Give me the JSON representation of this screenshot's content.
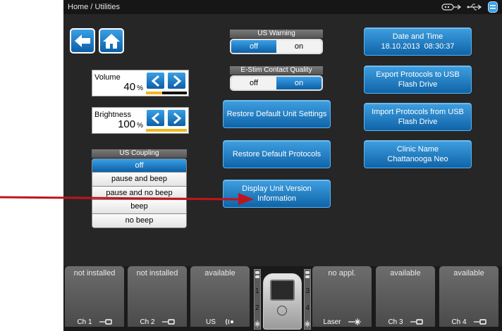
{
  "topbar": {
    "breadcrumb": "Home / Utilities",
    "icons": [
      "stim-probe-icon",
      "usb-icon",
      "storage-icon"
    ]
  },
  "nav": {
    "back": "back-arrow-icon",
    "home": "home-icon"
  },
  "volume": {
    "label": "Volume",
    "value": "40",
    "unit": "%",
    "level": 0.4
  },
  "brightness": {
    "label": "Brightness",
    "value": "100",
    "unit": "%",
    "level": 1.0
  },
  "us_coupling": {
    "title": "US Coupling",
    "options": [
      "off",
      "pause and beep",
      "pause and no beep",
      "beep",
      "no beep"
    ],
    "selected": "off"
  },
  "us_warning": {
    "title": "US Warning",
    "off": "off",
    "on": "on",
    "selected": "off"
  },
  "estim_contact": {
    "title": "E-Stim Contact Quality",
    "off": "off",
    "on": "on",
    "selected": "on"
  },
  "middle_buttons": {
    "restore_settings": "Restore Default Unit Settings",
    "restore_protocols": "Restore Default Protocols",
    "version_info": "Display Unit Version Information"
  },
  "right_buttons": {
    "datetime_title": "Date and Time",
    "datetime_value": "18.10.2013  08:30:37",
    "export": "Export Protocols to USB Flash Drive",
    "import": "Import Protocols from USB Flash Drive",
    "clinic_title": "Clinic Name",
    "clinic_value": "Chattanooga Neo"
  },
  "channels": [
    {
      "status": "not installed",
      "label": "Ch 1",
      "icon": "electrode-icon"
    },
    {
      "status": "not installed",
      "label": "Ch 2",
      "icon": "electrode-icon"
    },
    {
      "status": "available",
      "label": "US",
      "icon": "ultrasound-icon"
    },
    {
      "status": "no appl.",
      "label": "Laser",
      "icon": "laser-icon"
    },
    {
      "status": "available",
      "label": "Ch 3",
      "icon": "electrode-icon"
    },
    {
      "status": "available",
      "label": "Ch 4",
      "icon": "electrode-icon"
    }
  ],
  "device": {
    "slots": [
      "1",
      "2",
      "3",
      "4"
    ]
  },
  "colors": {
    "accent": "#1a7cc6",
    "level": "#f0b820",
    "annotation_arrow": "#c0141c"
  }
}
